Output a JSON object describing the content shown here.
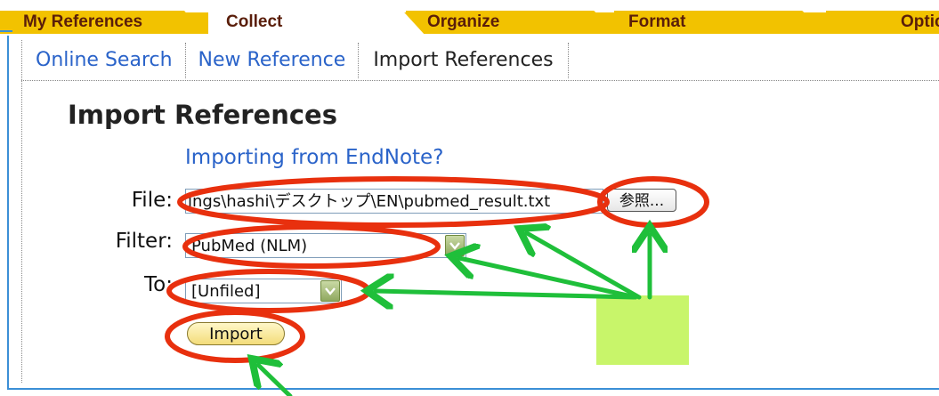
{
  "tabs": {
    "my_references": "My References",
    "collect": "Collect",
    "organize": "Organize",
    "format": "Format",
    "options": "Optic"
  },
  "subnav": {
    "online_search": "Online Search",
    "new_reference": "New Reference",
    "import_references": "Import References"
  },
  "page": {
    "title": "Import References",
    "endnote_link": "Importing from EndNote?"
  },
  "form": {
    "file_label": "File:",
    "file_value": "ings\\hashi\\デスクトップ\\EN\\pubmed_result.txt",
    "browse_label": "参照...",
    "filter_label": "Filter:",
    "filter_value": "PubMed (NLM)",
    "to_label": "To:",
    "to_value": "[Unfiled]",
    "import_label": "Import"
  },
  "colors": {
    "tab_bar": "#f2c200",
    "tab_text": "#5a1e0a",
    "link": "#2a63c9",
    "annotation_circle": "#e8300e",
    "annotation_arrow": "#1fbf3a",
    "annotation_box": "#c8f56a",
    "frame": "#3b8fd6"
  }
}
